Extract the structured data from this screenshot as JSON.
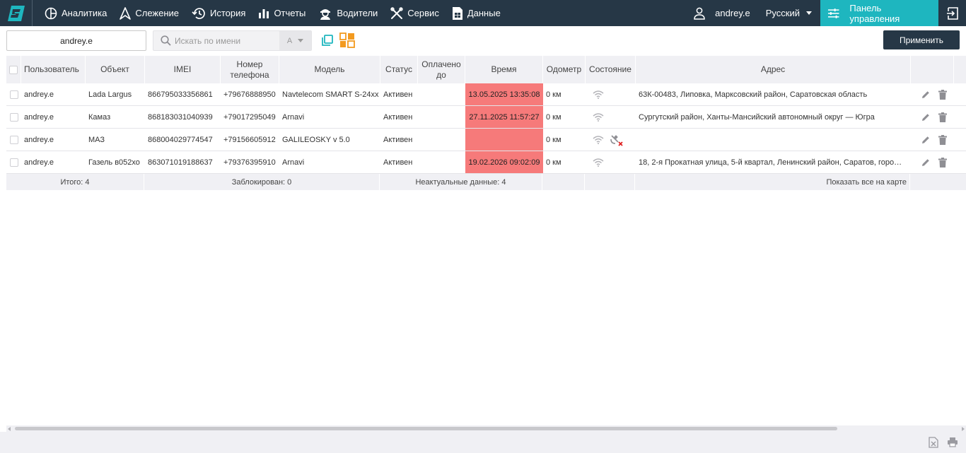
{
  "nav": {
    "items": [
      {
        "label": "Аналитика",
        "icon": "chart-pie-icon"
      },
      {
        "label": "Слежение",
        "icon": "navigation-arrow-icon"
      },
      {
        "label": "История",
        "icon": "history-icon"
      },
      {
        "label": "Отчеты",
        "icon": "bar-chart-icon"
      },
      {
        "label": "Водители",
        "icon": "driver-icon"
      },
      {
        "label": "Сервис",
        "icon": "wrench-icon"
      },
      {
        "label": "Данные",
        "icon": "sim-card-icon"
      }
    ],
    "username": "andrey.e",
    "language": "Русский",
    "control_panel": "Панель управления",
    "accent_color": "#1eb6bf",
    "bar_color": "#263746"
  },
  "toolbar": {
    "user_filter_value": "andrey.e",
    "search_placeholder": "Искать по имени",
    "sort_label": "A",
    "apply_label": "Применить"
  },
  "table": {
    "columns": {
      "user": "Пользователь",
      "object": "Объект",
      "imei": "IMEI",
      "phone": "Номер телефона",
      "model": "Модель",
      "status": "Статус",
      "paid": "Оплачено до",
      "time": "Время",
      "odometer": "Одометр",
      "state": "Состояние",
      "address": "Адрес"
    },
    "rows": [
      {
        "user": "andrey.e",
        "object": "Lada Largus",
        "imei": "866795033356861",
        "phone": "+79676888950",
        "model": "Navtelecom SMART S-24xx",
        "status": "Активен",
        "paid": "",
        "time": "13.05.2025 13:35:08",
        "odometer": "0 км",
        "no_gps": false,
        "address": "63К-00483, Липовка, Марксовский район, Саратовская область"
      },
      {
        "user": "andrey.e",
        "object": "Камаз",
        "imei": "868183031040939",
        "phone": "+79017295049",
        "model": "Arnavi",
        "status": "Активен",
        "paid": "",
        "time": "27.11.2025 11:57:27",
        "odometer": "0 км",
        "no_gps": false,
        "address": "Сургутский район, Ханты-Мансийский автономный округ — Югра"
      },
      {
        "user": "andrey.e",
        "object": "МАЗ",
        "imei": "868004029774547",
        "phone": "+79156605912",
        "model": "GALILEOSKY v 5.0",
        "status": "Активен",
        "paid": "",
        "time": "",
        "odometer": "0 км",
        "no_gps": true,
        "address": ""
      },
      {
        "user": "andrey.e",
        "object": "Газель в052хо",
        "imei": "863071019188637",
        "phone": "+79376395910",
        "model": "Arnavi",
        "status": "Активен",
        "paid": "",
        "time": "19.02.2026 09:02:09",
        "odometer": "0 км",
        "no_gps": false,
        "address": "18, 2-я Прокатная улица, 5-й квартал, Ленинский район, Саратов, горо…"
      }
    ],
    "footer": {
      "total": "Итого: 4",
      "blocked": "Заблокирован: 0",
      "stale": "Неактуальные данные: 4",
      "show_map": "Показать все на карте"
    },
    "stale_time_color": "#f67a7a"
  }
}
